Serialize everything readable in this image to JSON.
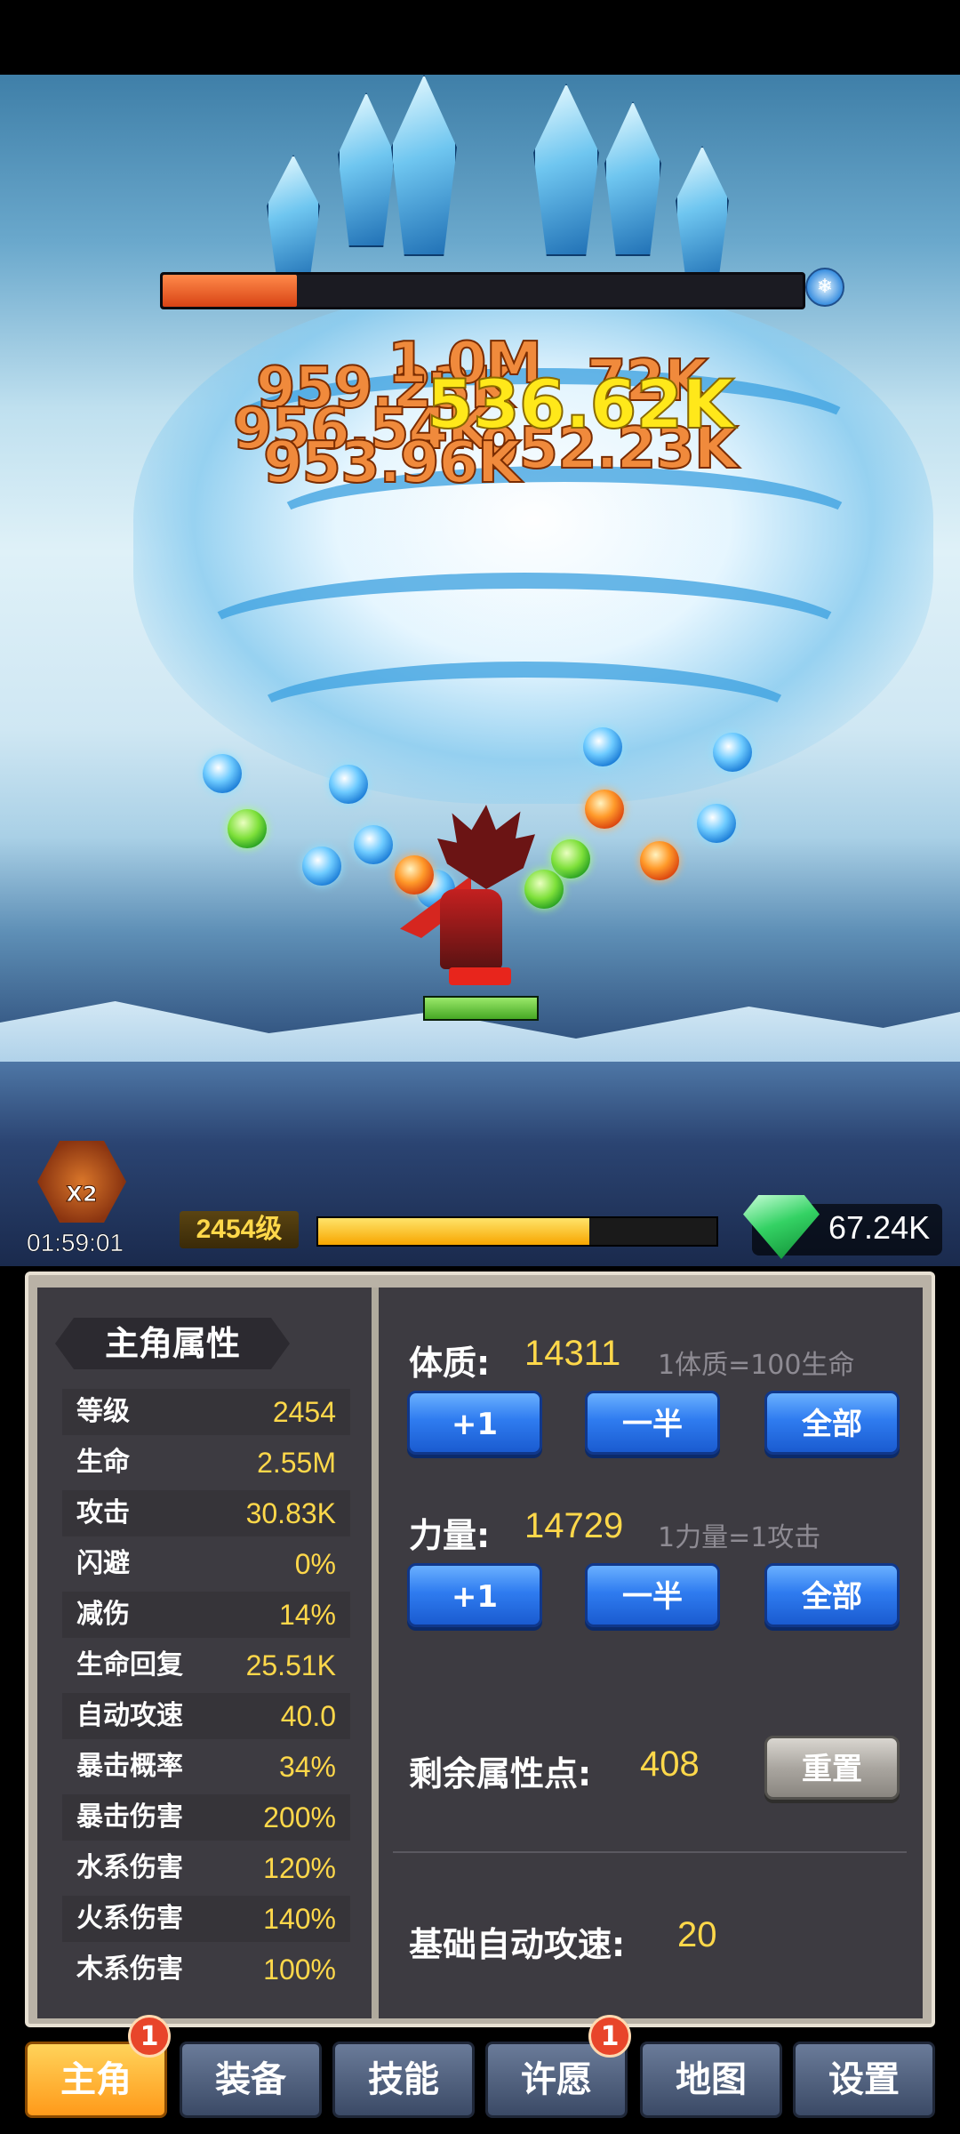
{
  "battle": {
    "boss_hp_fraction": 0.21,
    "boss_element_icon": "ice-snowflake-icon",
    "hero_hp_fraction": 1.0,
    "damage_numbers": [
      {
        "text": "959.23K",
        "color": "orange"
      },
      {
        "text": "956.54K",
        "color": "orange"
      },
      {
        "text": "953.96K",
        "color": "orange"
      },
      {
        "text": "952.23K",
        "color": "orange"
      },
      {
        "text": "1.0M",
        "color": "orange"
      },
      {
        "text": "72K",
        "color": "orange"
      },
      {
        "text": "536.62K",
        "color": "yellow"
      }
    ]
  },
  "buff": {
    "label": "X2",
    "timer": "01:59:01",
    "icon": "double-reward-icon"
  },
  "level": {
    "label": "2454级",
    "xp_fraction": 0.68
  },
  "currency": {
    "icon": "gem-icon",
    "value": "67.24K"
  },
  "stats_panel": {
    "title": "主角属性",
    "rows": [
      {
        "label": "等级",
        "value": "2454"
      },
      {
        "label": "生命",
        "value": "2.55M"
      },
      {
        "label": "攻击",
        "value": "30.83K"
      },
      {
        "label": "闪避",
        "value": "0%"
      },
      {
        "label": "减伤",
        "value": "14%"
      },
      {
        "label": "生命回复",
        "value": "25.51K"
      },
      {
        "label": "自动攻速",
        "value": "40.0"
      },
      {
        "label": "暴击概率",
        "value": "34%"
      },
      {
        "label": "暴击伤害",
        "value": "200%"
      },
      {
        "label": "水系伤害",
        "value": "120%"
      },
      {
        "label": "火系伤害",
        "value": "140%"
      },
      {
        "label": "木系伤害",
        "value": "100%"
      }
    ]
  },
  "attributes": {
    "constitution": {
      "label": "体质:",
      "value": "14311",
      "hint": "1体质=100生命"
    },
    "strength": {
      "label": "力量:",
      "value": "14729",
      "hint": "1力量=1攻击"
    },
    "buttons": {
      "plus_one": "+1",
      "half": "一半",
      "all": "全部"
    },
    "remaining_label": "剩余属性点:",
    "remaining_value": "408",
    "reset_label": "重置",
    "base_speed_label": "基础自动攻速:",
    "base_speed_value": "20"
  },
  "tabs": [
    {
      "label": "主角",
      "active": true,
      "badge": "1"
    },
    {
      "label": "装备",
      "active": false,
      "badge": ""
    },
    {
      "label": "技能",
      "active": false,
      "badge": ""
    },
    {
      "label": "许愿",
      "active": false,
      "badge": "1"
    },
    {
      "label": "地图",
      "active": false,
      "badge": ""
    },
    {
      "label": "设置",
      "active": false,
      "badge": ""
    }
  ]
}
